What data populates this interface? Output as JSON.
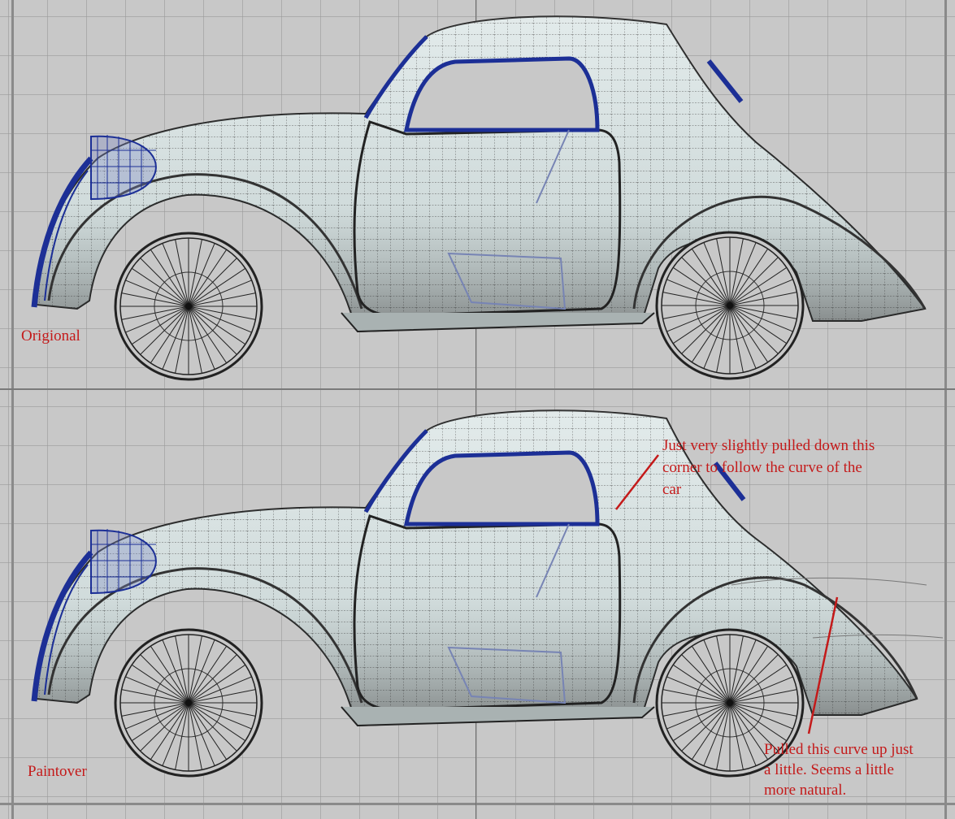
{
  "annotations": {
    "original_label": "Origional",
    "paintover_label": "Paintover",
    "roof_note": [
      "Just very slightly pulled down this",
      "corner to follow the curve of the",
      "car"
    ],
    "curve_note": [
      "Pulled this curve up just",
      "a little. Seems a little",
      "more natural."
    ]
  },
  "colors": {
    "annotation": "#c41a1a",
    "body_surface": "#dfe8e8",
    "selection_wire": "#1c2f96",
    "viewport_bg": "#c8c8c8"
  },
  "icons": {
    "wheel": "wheel-icon",
    "headlight": "headlight-wireframe-icon"
  }
}
